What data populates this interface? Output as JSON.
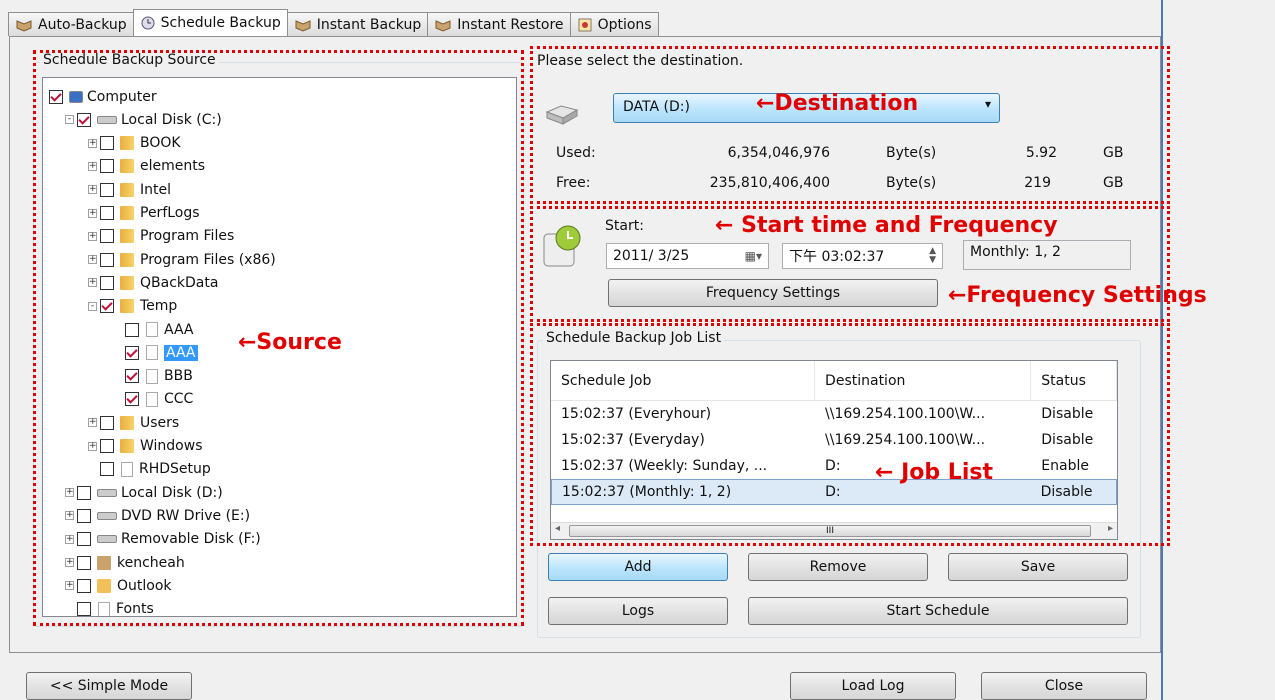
{
  "tabs": [
    "Auto-Backup",
    "Schedule Backup",
    "Instant Backup",
    "Instant Restore",
    "Options"
  ],
  "source": {
    "title": "Schedule Backup Source",
    "tree": [
      {
        "label": "Computer",
        "level": 0,
        "checked": true,
        "icon": "computer"
      },
      {
        "label": "Local Disk (C:)",
        "level": 1,
        "checked": true,
        "icon": "disk",
        "expander": "-"
      },
      {
        "label": "BOOK",
        "level": 2,
        "checked": false,
        "icon": "folder",
        "expander": "+"
      },
      {
        "label": "elements",
        "level": 2,
        "checked": false,
        "icon": "folder",
        "expander": "+"
      },
      {
        "label": "Intel",
        "level": 2,
        "checked": false,
        "icon": "folder",
        "expander": "+"
      },
      {
        "label": "PerfLogs",
        "level": 2,
        "checked": false,
        "icon": "folder",
        "expander": "+"
      },
      {
        "label": "Program Files",
        "level": 2,
        "checked": false,
        "icon": "folder",
        "expander": "+"
      },
      {
        "label": "Program Files (x86)",
        "level": 2,
        "checked": false,
        "icon": "folder",
        "expander": "+"
      },
      {
        "label": "QBackData",
        "level": 2,
        "checked": false,
        "icon": "folder",
        "expander": "+"
      },
      {
        "label": "Temp",
        "level": 2,
        "checked": true,
        "icon": "folder",
        "expander": "-"
      },
      {
        "label": "AAA",
        "level": 3,
        "checked": false,
        "icon": "file"
      },
      {
        "label": "AAA",
        "level": 3,
        "checked": true,
        "icon": "file",
        "selected": true
      },
      {
        "label": "BBB",
        "level": 3,
        "checked": true,
        "icon": "file"
      },
      {
        "label": "CCC",
        "level": 3,
        "checked": true,
        "icon": "file"
      },
      {
        "label": "Users",
        "level": 2,
        "checked": false,
        "icon": "folder",
        "expander": "+"
      },
      {
        "label": "Windows",
        "level": 2,
        "checked": false,
        "icon": "folder",
        "expander": "+"
      },
      {
        "label": "RHDSetup",
        "level": 2,
        "checked": false,
        "icon": "file"
      },
      {
        "label": "Local Disk (D:)",
        "level": 1,
        "checked": false,
        "icon": "disk",
        "expander": "+"
      },
      {
        "label": "DVD RW Drive (E:)",
        "level": 1,
        "checked": false,
        "icon": "dvd",
        "expander": "+"
      },
      {
        "label": "Removable Disk (F:)",
        "level": 1,
        "checked": false,
        "icon": "disk",
        "expander": "+"
      },
      {
        "label": "kencheah",
        "level": 1,
        "checked": false,
        "icon": "user",
        "expander": "+"
      },
      {
        "label": "Outlook",
        "level": 1,
        "checked": false,
        "icon": "outlook",
        "expander": "+"
      },
      {
        "label": "Fonts",
        "level": 1,
        "checked": false,
        "icon": "fonts"
      }
    ]
  },
  "destination": {
    "prompt": "Please select the destination.",
    "selected": "DATA (D:)",
    "used": {
      "label": "Used:",
      "bytes": "6,354,046,976",
      "unit": "Byte(s)",
      "size": "5.92",
      "size_unit": "GB"
    },
    "free": {
      "label": "Free:",
      "bytes": "235,810,406,400",
      "unit": "Byte(s)",
      "size": "219",
      "size_unit": "GB"
    }
  },
  "schedule": {
    "start_label": "Start:",
    "date": "2011/ 3/25",
    "time": "下午 03:02:37",
    "freq_summary": "Monthly: 1, 2",
    "freq_button": "Frequency Settings"
  },
  "joblist": {
    "title": "Schedule Backup Job List",
    "columns": [
      "Schedule Job",
      "Destination",
      "Status"
    ],
    "rows": [
      [
        "15:02:37 (Everyhour)",
        "\\\\169.254.100.100\\W...",
        "Disable"
      ],
      [
        "15:02:37 (Everyday)",
        "\\\\169.254.100.100\\W...",
        "Disable"
      ],
      [
        "15:02:37 (Weekly: Sunday, ...",
        "D:",
        "Enable"
      ],
      [
        "15:02:37 (Monthly: 1, 2)",
        "D:",
        "Disable"
      ]
    ],
    "selected_row": 3,
    "scroll_grip": "III"
  },
  "buttons": {
    "add": "Add",
    "remove": "Remove",
    "save": "Save",
    "logs": "Logs",
    "start_schedule": "Start Schedule",
    "simple_mode": "<< Simple Mode",
    "load_log": "Load Log",
    "close": "Close"
  },
  "annotations": {
    "destination": "←Destination",
    "start": "← Start time and Frequency",
    "freq": "←Frequency Settings",
    "source": "←Source",
    "joblist": "← Job List"
  },
  "colors": {
    "annotation": "#e00000",
    "accent": "#3399ff"
  }
}
